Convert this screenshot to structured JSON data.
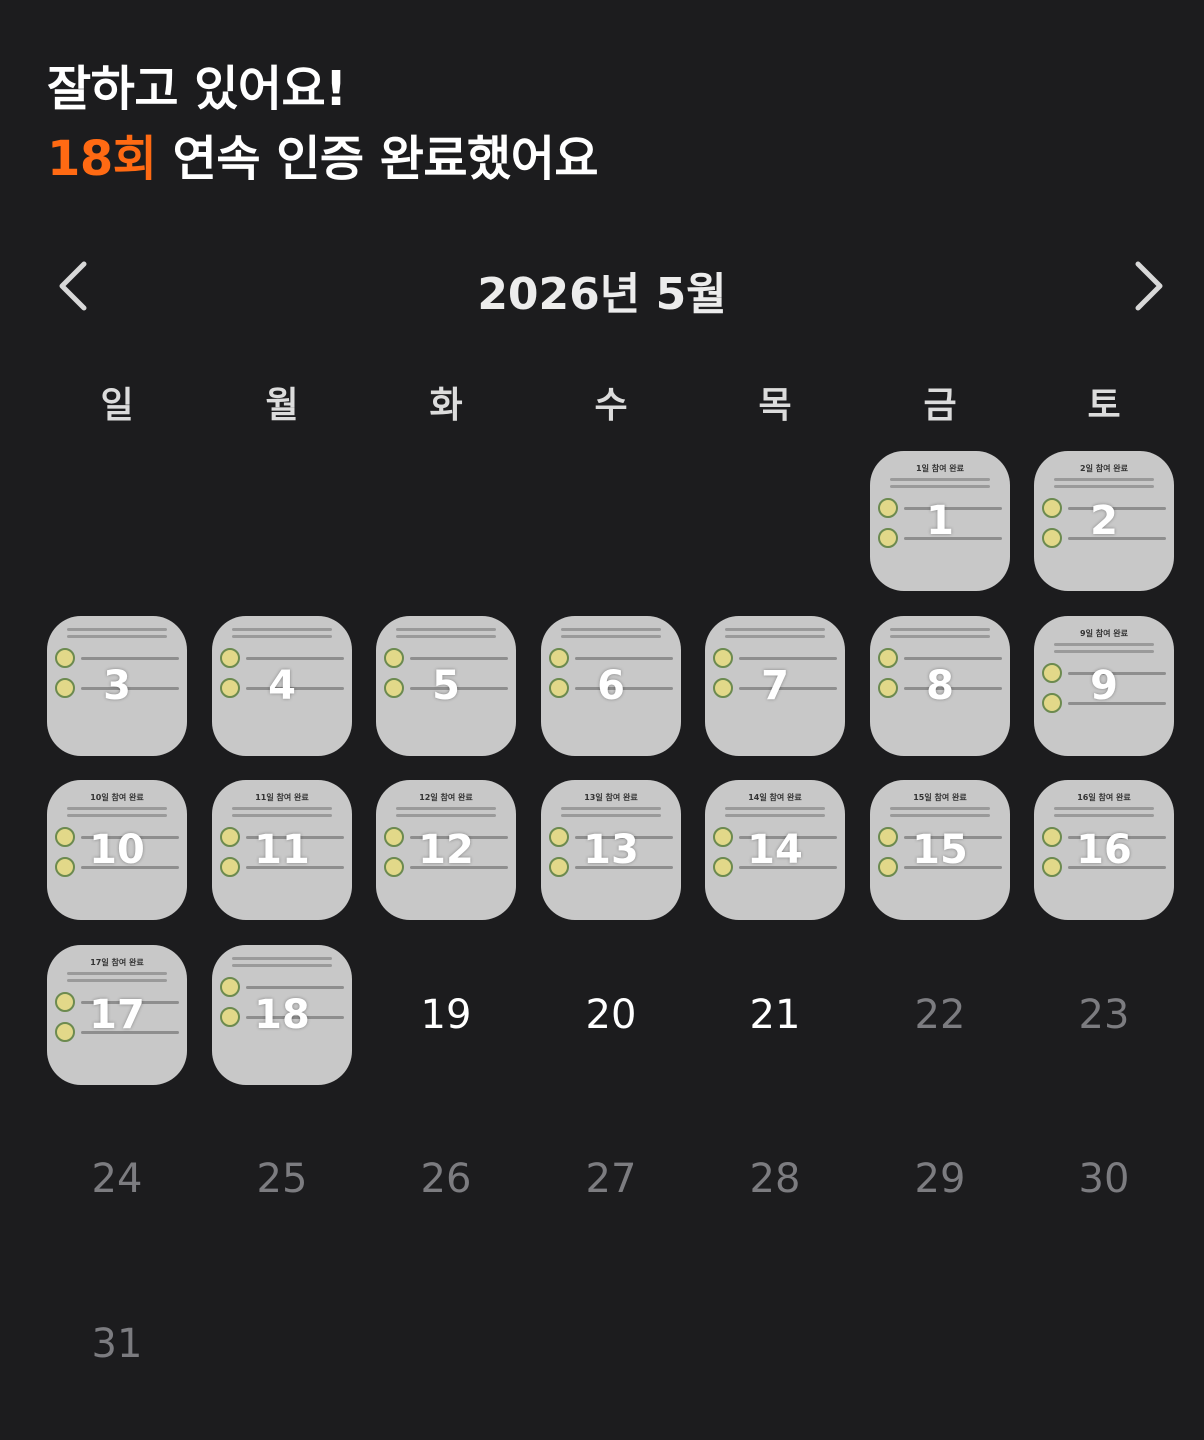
{
  "header": {
    "line1": "잘하고 있어요!",
    "streak_count": "18회",
    "line2_rest": " 연속 인증 완료했어요"
  },
  "nav": {
    "month_title": "2026년 5월",
    "prev_icon": "chevron-left-icon",
    "next_icon": "chevron-right-icon"
  },
  "weekdays": [
    "일",
    "월",
    "화",
    "수",
    "목",
    "금",
    "토"
  ],
  "colors": {
    "background": "#1c1c1e",
    "accent": "#ff6a13",
    "completed_tile": "#c8c8c8",
    "future_day": "#7c7c80"
  },
  "calendar": {
    "completed_days": [
      1,
      2,
      3,
      4,
      5,
      6,
      7,
      8,
      9,
      10,
      11,
      12,
      13,
      14,
      15,
      16,
      17,
      18
    ],
    "days": [
      {
        "n": "1",
        "status": "done",
        "title": "1일 참여 완료"
      },
      {
        "n": "2",
        "status": "done",
        "title": "2일 참여 완료"
      },
      {
        "n": "3",
        "status": "done",
        "title": ""
      },
      {
        "n": "4",
        "status": "done",
        "title": ""
      },
      {
        "n": "5",
        "status": "done",
        "title": ""
      },
      {
        "n": "6",
        "status": "done",
        "title": ""
      },
      {
        "n": "7",
        "status": "done",
        "title": ""
      },
      {
        "n": "8",
        "status": "done",
        "title": ""
      },
      {
        "n": "9",
        "status": "done",
        "title": "9일 참여 완료"
      },
      {
        "n": "10",
        "status": "done",
        "title": "10일 참여 완료"
      },
      {
        "n": "11",
        "status": "done",
        "title": "11일 참여 완료"
      },
      {
        "n": "12",
        "status": "done",
        "title": "12일 참여 완료"
      },
      {
        "n": "13",
        "status": "done",
        "title": "13일 참여 완료"
      },
      {
        "n": "14",
        "status": "done",
        "title": "14일 참여 완료"
      },
      {
        "n": "15",
        "status": "done",
        "title": "15일 참여 완료"
      },
      {
        "n": "16",
        "status": "done",
        "title": "16일 참여 완료"
      },
      {
        "n": "17",
        "status": "done",
        "title": "17일 참여 완료"
      },
      {
        "n": "18",
        "status": "done",
        "title": ""
      },
      {
        "n": "19",
        "status": "open"
      },
      {
        "n": "20",
        "status": "open"
      },
      {
        "n": "21",
        "status": "open"
      },
      {
        "n": "22",
        "status": "future"
      },
      {
        "n": "23",
        "status": "future"
      },
      {
        "n": "24",
        "status": "future"
      },
      {
        "n": "25",
        "status": "future"
      },
      {
        "n": "26",
        "status": "future"
      },
      {
        "n": "27",
        "status": "future"
      },
      {
        "n": "28",
        "status": "future"
      },
      {
        "n": "29",
        "status": "future"
      },
      {
        "n": "30",
        "status": "future"
      },
      {
        "n": "31",
        "status": "future"
      }
    ]
  }
}
